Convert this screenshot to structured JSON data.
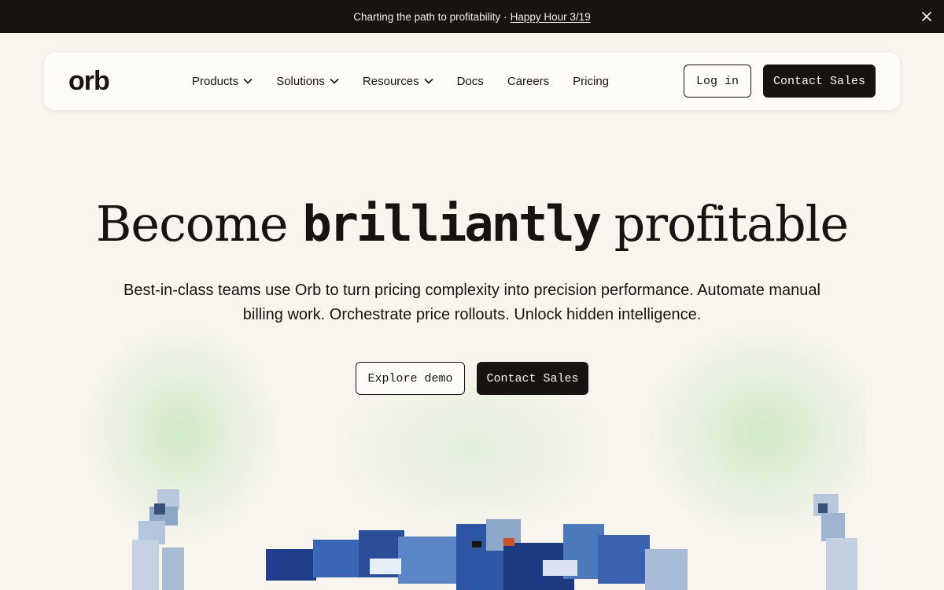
{
  "announcement": {
    "text": "Charting the path to profitability",
    "separator": "·",
    "link": "Happy Hour 3/19"
  },
  "nav": {
    "logo": "orb",
    "items": [
      {
        "label": "Products",
        "dropdown": true
      },
      {
        "label": "Solutions",
        "dropdown": true
      },
      {
        "label": "Resources",
        "dropdown": true
      },
      {
        "label": "Docs",
        "dropdown": false
      },
      {
        "label": "Careers",
        "dropdown": false
      },
      {
        "label": "Pricing",
        "dropdown": false
      }
    ],
    "login_label": "Log in",
    "contact_label": "Contact Sales"
  },
  "hero": {
    "headline_start": "Become",
    "headline_pixel": "brilliantly",
    "headline_end": "profitable",
    "subtitle": "Best-in-class teams use Orb to turn pricing complexity into precision performance. Automate manual billing work. Orchestrate price rollouts. Unlock hidden intelligence.",
    "demo_label": "Explore demo",
    "contact_label": "Contact Sales"
  },
  "colors": {
    "background": "#f8f5ef",
    "ink": "#161310",
    "glow": "#afe1a5",
    "art_blue": "#2f5aa8"
  },
  "icons": {
    "close": "close-icon",
    "dropdown": "chevron-down-icon"
  }
}
